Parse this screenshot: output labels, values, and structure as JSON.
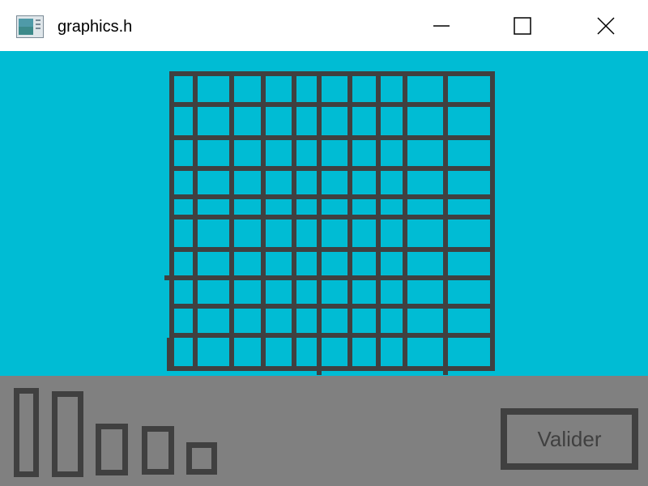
{
  "window": {
    "title": "graphics.h",
    "app_icon": "app-window-icon",
    "controls": [
      "minimize-icon",
      "maximize-icon",
      "close-icon"
    ]
  },
  "colors": {
    "canvas_bg": "#00bcd4",
    "grid_line": "#404040",
    "toolbar_bg": "#808080",
    "titlebar_bg": "#ffffff"
  },
  "toolbar": {
    "piece_count": 5,
    "valider_label": "Valider"
  }
}
